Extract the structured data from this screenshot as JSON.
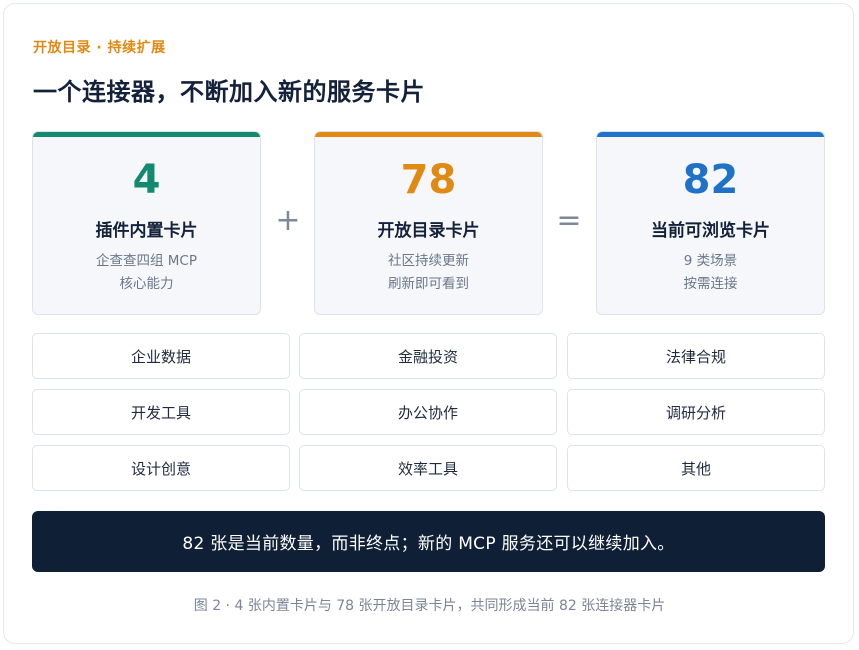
{
  "header": {
    "eyebrow": "开放目录 · 持续扩展",
    "title": "一个连接器，不断加入新的服务卡片"
  },
  "stats": [
    {
      "number": "4",
      "label": "插件内置卡片",
      "desc_line1": "企查查四组 MCP",
      "desc_line2": "核心能力",
      "color": "#13896f"
    },
    {
      "number": "78",
      "label": "开放目录卡片",
      "desc_line1": "社区持续更新",
      "desc_line2": "刷新即可看到",
      "color": "#e08a13"
    },
    {
      "number": "82",
      "label": "当前可浏览卡片",
      "desc_line1": "9 类场景",
      "desc_line2": "按需连接",
      "color": "#1f72c8"
    }
  ],
  "operators": {
    "plus": "+",
    "equals": "="
  },
  "categories": [
    "企业数据",
    "金融投资",
    "法律合规",
    "开发工具",
    "办公协作",
    "调研分析",
    "设计创意",
    "效率工具",
    "其他"
  ],
  "banner": "82 张是当前数量，而非终点；新的 MCP 服务还可以继续加入。",
  "caption": "图 2 · 4 张内置卡片与 78 张开放目录卡片，共同形成当前 82 张连接器卡片"
}
